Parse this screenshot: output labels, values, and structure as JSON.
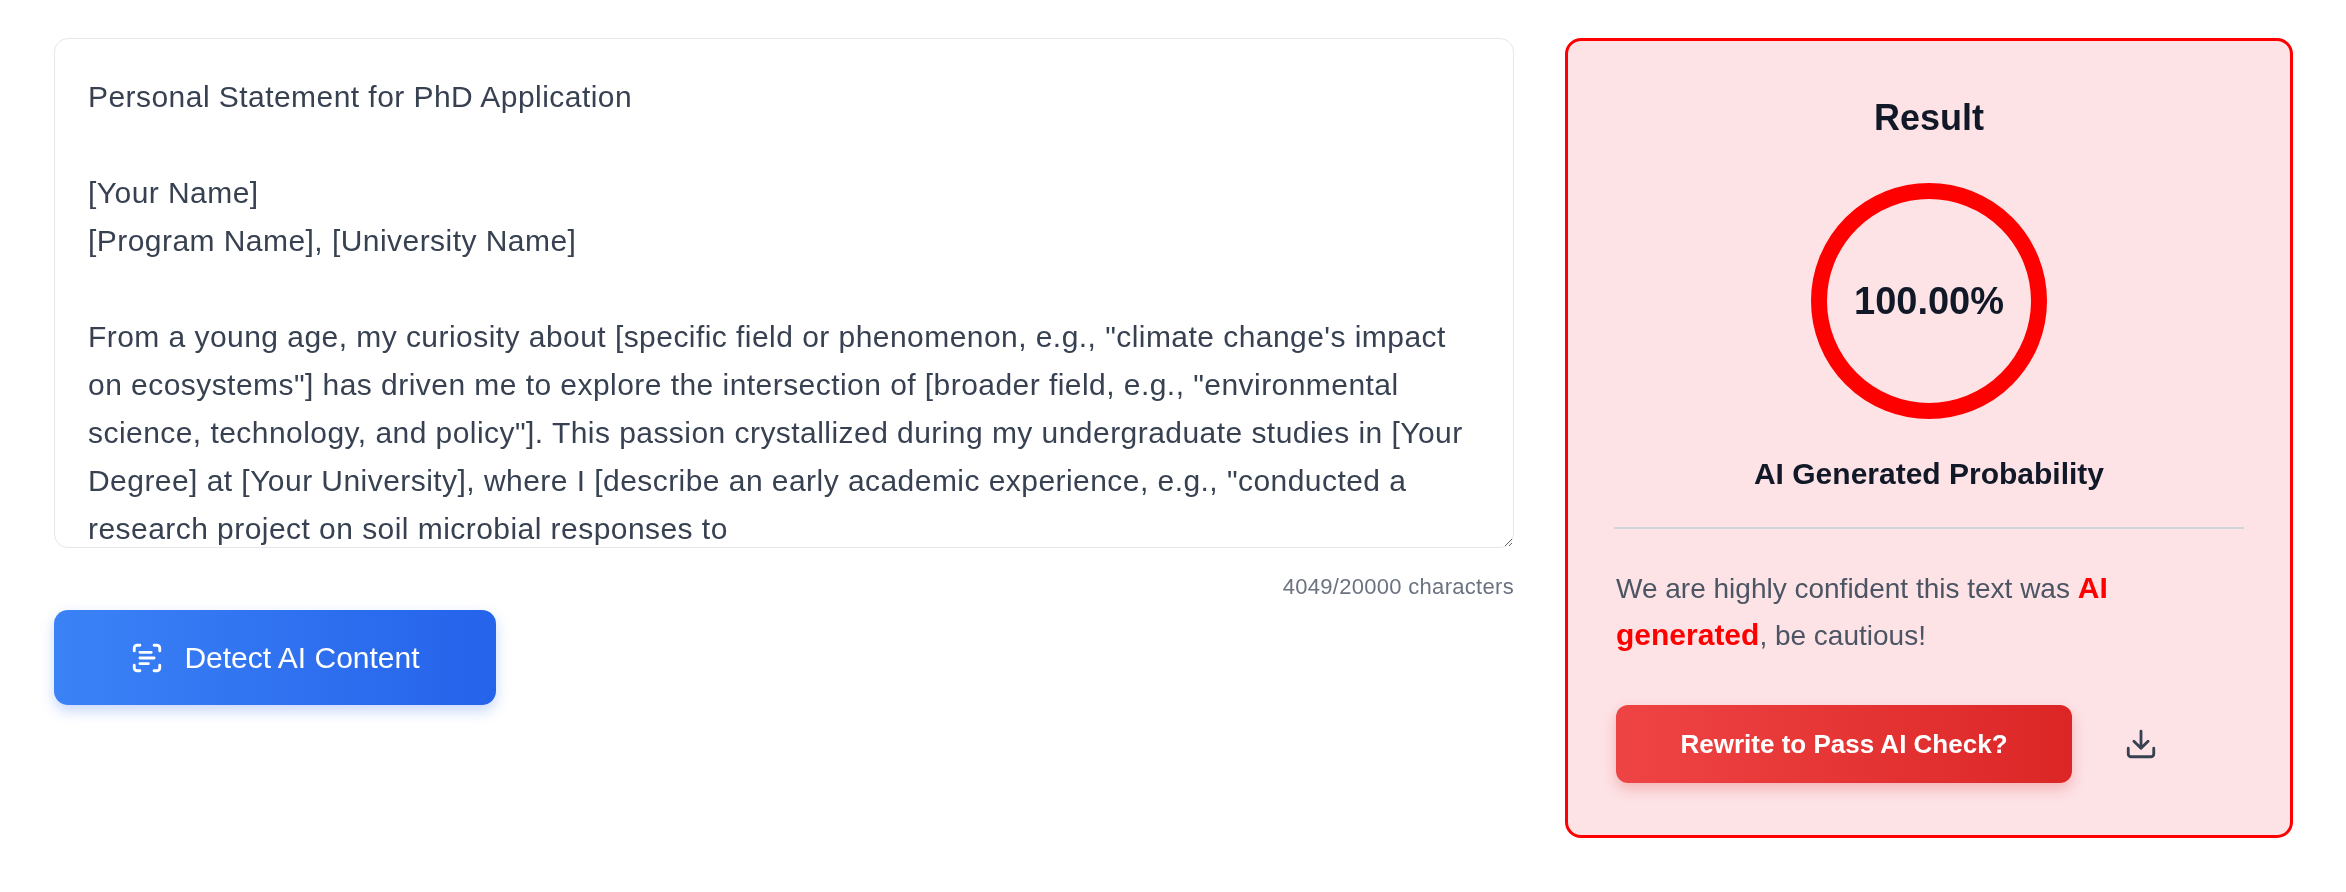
{
  "editor": {
    "value": "Personal Statement for PhD Application\n\n[Your Name]\n[Program Name], [University Name]\n\nFrom a young age, my curiosity about [specific field or phenomenon, e.g., \"climate change's impact on ecosystems\"] has driven me to explore the intersection of [broader field, e.g., \"environmental science, technology, and policy\"]. This passion crystallized during my undergraduate studies in [Your Degree] at [Your University], where I [describe an early academic experience, e.g., \"conducted a research project on soil microbial responses to",
    "char_count": "4049/20000 characters"
  },
  "detect_button": {
    "label": "Detect AI Content"
  },
  "result": {
    "title": "Result",
    "percent": "100.00%",
    "caption": "AI Generated Probability",
    "message": "We are highly confident this text was **AI generated**, be cautious!",
    "rewrite_button": "Rewrite to Pass AI Check?"
  }
}
